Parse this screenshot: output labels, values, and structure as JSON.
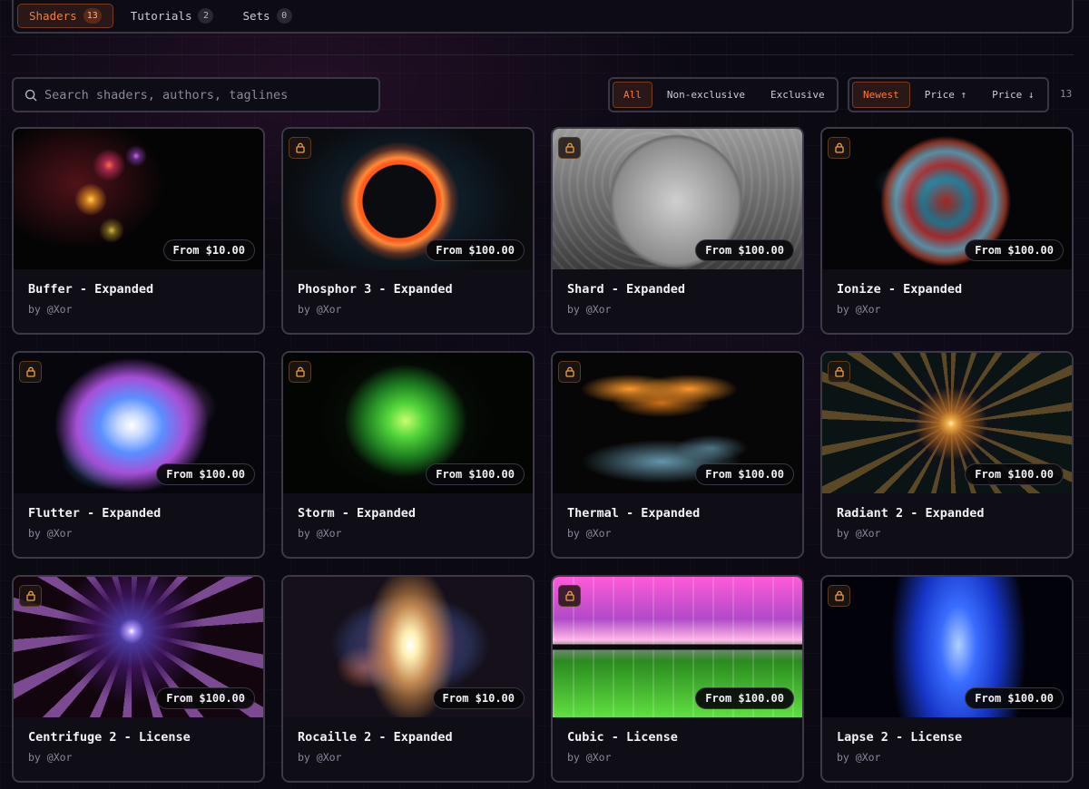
{
  "tabs": [
    {
      "label": "Shaders",
      "count": "13",
      "active": true
    },
    {
      "label": "Tutorials",
      "count": "2",
      "active": false
    },
    {
      "label": "Sets",
      "count": "0",
      "active": false
    }
  ],
  "search": {
    "placeholder": "Search shaders, authors, taglines",
    "value": ""
  },
  "license_filter": {
    "options": [
      "All",
      "Non-exclusive",
      "Exclusive"
    ],
    "selected": "All"
  },
  "sort": {
    "options": [
      "Newest",
      "Price ↑",
      "Price ↓"
    ],
    "selected": "Newest"
  },
  "result_count": "13",
  "colors": {
    "accent": "#ff7a2e",
    "background": "#0b0912",
    "card_border": "#3d3947"
  },
  "cards": [
    {
      "title": "Buffer - Expanded",
      "author": "by @Xor",
      "price": "From $10.00",
      "locked": false
    },
    {
      "title": "Phosphor 3 - Expanded",
      "author": "by @Xor",
      "price": "From $100.00",
      "locked": true
    },
    {
      "title": "Shard - Expanded",
      "author": "by @Xor",
      "price": "From $100.00",
      "locked": true
    },
    {
      "title": "Ionize - Expanded",
      "author": "by @Xor",
      "price": "From $100.00",
      "locked": true
    },
    {
      "title": "Flutter - Expanded",
      "author": "by @Xor",
      "price": "From $100.00",
      "locked": true
    },
    {
      "title": "Storm - Expanded",
      "author": "by @Xor",
      "price": "From $100.00",
      "locked": true
    },
    {
      "title": "Thermal - Expanded",
      "author": "by @Xor",
      "price": "From $100.00",
      "locked": true
    },
    {
      "title": "Radiant 2 - Expanded",
      "author": "by @Xor",
      "price": "From $100.00",
      "locked": true
    },
    {
      "title": "Centrifuge 2 - License",
      "author": "by @Xor",
      "price": "From $100.00",
      "locked": true
    },
    {
      "title": "Rocaille 2 - Expanded",
      "author": "by @Xor",
      "price": "From $10.00",
      "locked": false
    },
    {
      "title": "Cubic - License",
      "author": "by @Xor",
      "price": "From $100.00",
      "locked": true
    },
    {
      "title": "Lapse 2 - License",
      "author": "by @Xor",
      "price": "From $100.00",
      "locked": true
    }
  ]
}
